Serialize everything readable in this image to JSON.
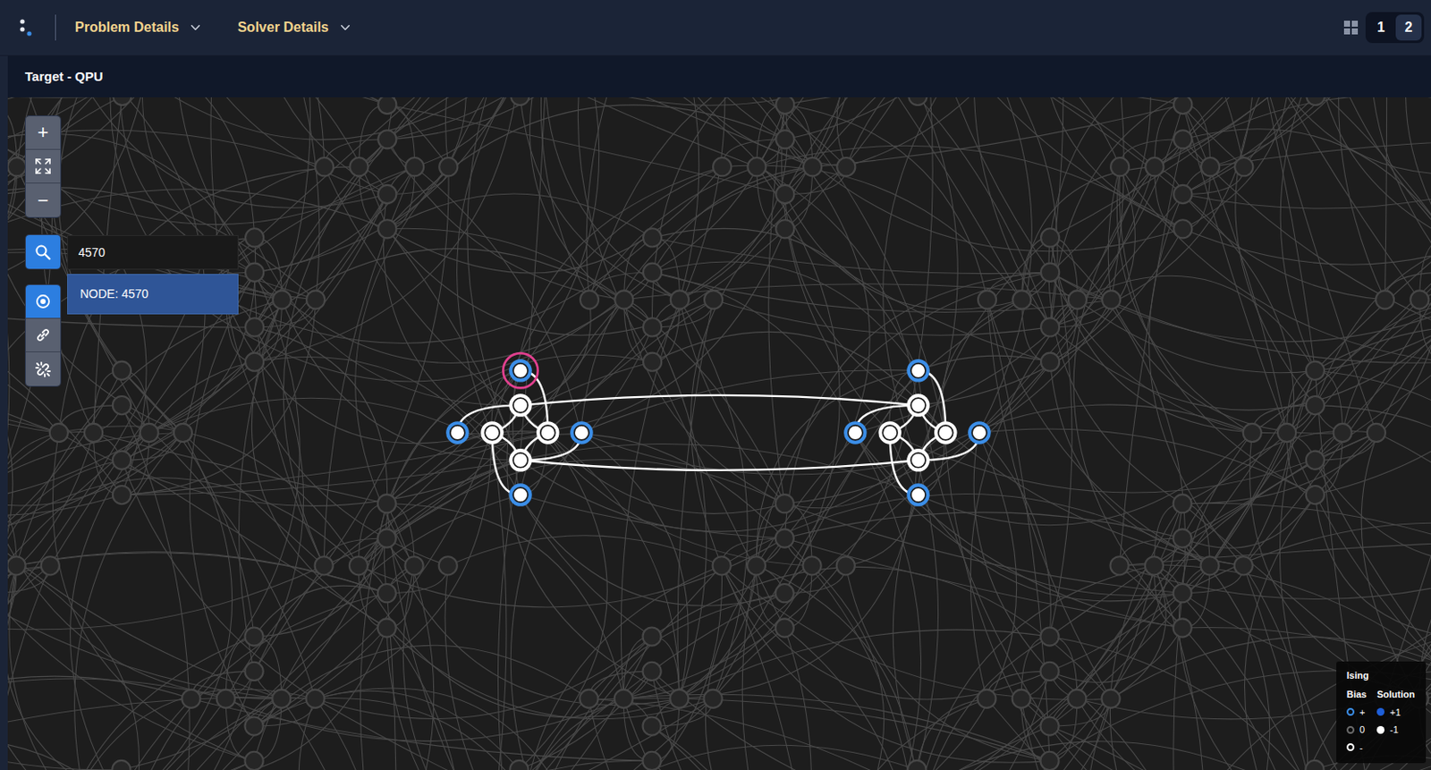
{
  "toolbar": {
    "menus": [
      {
        "label": "Problem Details",
        "expanded": false
      },
      {
        "label": "Solver Details",
        "expanded": false
      }
    ],
    "layout_buttons": [
      {
        "label": "1",
        "selected": false
      },
      {
        "label": "2",
        "selected": true
      }
    ]
  },
  "panel": {
    "title": "Target - QPU"
  },
  "zoom": {
    "zoom_in": "+",
    "zoom_out": "−"
  },
  "search": {
    "value": "4570",
    "results": [
      {
        "label": "NODE: 4570",
        "selected": true
      }
    ]
  },
  "tools": [
    {
      "kind": "select",
      "selected": true
    },
    {
      "kind": "link",
      "selected": false
    },
    {
      "kind": "unlink",
      "selected": false
    }
  ],
  "graph": {
    "nodes": [
      {
        "bias": "+",
        "solution": "-1",
        "selected": true
      },
      {
        "bias": "-",
        "solution": "-1",
        "selected": false
      },
      {
        "bias": "+",
        "solution": "-1",
        "selected": false
      },
      {
        "bias": "-",
        "solution": "-1",
        "selected": false
      },
      {
        "bias": "-",
        "solution": "-1",
        "selected": false
      },
      {
        "bias": "+",
        "solution": "-1",
        "selected": false
      },
      {
        "bias": "-",
        "solution": "-1",
        "selected": false
      },
      {
        "bias": "+",
        "solution": "-1",
        "selected": false
      },
      {
        "bias": "+",
        "solution": "-1",
        "selected": false
      },
      {
        "bias": "-",
        "solution": "-1",
        "selected": false
      },
      {
        "bias": "+",
        "solution": "-1",
        "selected": false
      },
      {
        "bias": "-",
        "solution": "-1",
        "selected": false
      },
      {
        "bias": "-",
        "solution": "-1",
        "selected": false
      },
      {
        "bias": "+",
        "solution": "-1",
        "selected": false
      },
      {
        "bias": "-",
        "solution": "-1",
        "selected": false
      },
      {
        "bias": "+",
        "solution": "-1",
        "selected": false
      }
    ],
    "edges": [
      [
        0,
        4
      ],
      [
        2,
        1
      ],
      [
        5,
        6
      ],
      [
        7,
        3
      ],
      [
        1,
        3
      ],
      [
        1,
        4
      ],
      [
        3,
        6
      ],
      [
        4,
        6
      ],
      [
        8,
        12
      ],
      [
        10,
        9
      ],
      [
        13,
        14
      ],
      [
        15,
        11
      ],
      [
        9,
        11
      ],
      [
        9,
        12
      ],
      [
        11,
        14
      ],
      [
        12,
        14
      ],
      [
        1,
        9
      ],
      [
        6,
        14
      ]
    ]
  },
  "legend": {
    "title": "Ising",
    "bias_header": "Bias",
    "solution_header": "Solution",
    "bias": [
      {
        "label": "+",
        "color": "#3b8ee8"
      },
      {
        "label": "0",
        "color": "#6b6b6b"
      },
      {
        "label": "-",
        "color": "#ffffff"
      }
    ],
    "solution": [
      {
        "label": "+1",
        "color": "#1e5fd9"
      },
      {
        "label": "-1",
        "color": "#ffffff"
      }
    ]
  }
}
